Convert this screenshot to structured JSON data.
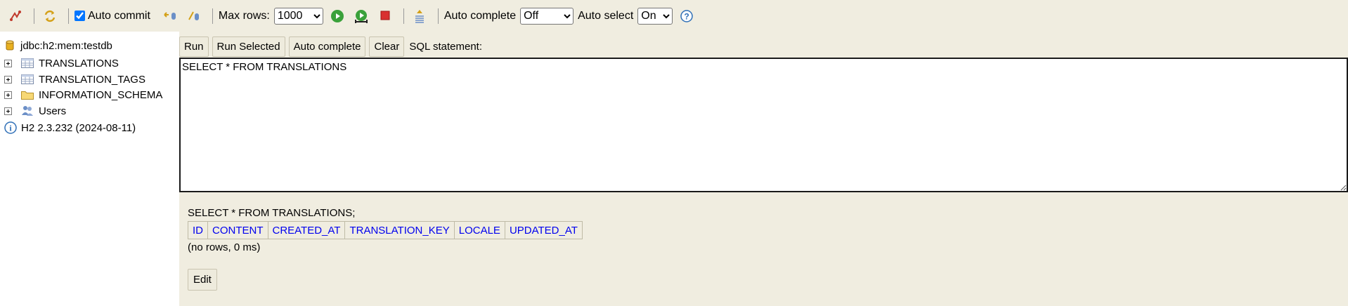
{
  "toolbar": {
    "disconnect_icon": "disconnect-icon",
    "refresh_icon": "refresh-icon",
    "auto_commit_label": "Auto commit",
    "auto_commit_checked": true,
    "rollback_icon": "rollback-icon",
    "commit_icon": "commit-icon",
    "max_rows_label": "Max rows:",
    "max_rows_value": "1000",
    "run_icon": "run-icon",
    "run_selected_icon": "run-selected-icon",
    "stop_icon": "stop-icon",
    "history_icon": "history-icon",
    "auto_complete_label": "Auto complete",
    "auto_complete_value": "Off",
    "auto_select_label": "Auto select",
    "auto_select_value": "On",
    "help_icon": "help-icon"
  },
  "tree": {
    "connection": "jdbc:h2:mem:testdb",
    "items": [
      {
        "label": "TRANSLATIONS",
        "icon": "table-icon"
      },
      {
        "label": "TRANSLATION_TAGS",
        "icon": "table-icon"
      },
      {
        "label": "INFORMATION_SCHEMA",
        "icon": "folder-icon"
      },
      {
        "label": "Users",
        "icon": "users-icon"
      }
    ],
    "version": "H2 2.3.232 (2024-08-11)"
  },
  "editor": {
    "buttons": {
      "run": "Run",
      "run_selected": "Run Selected",
      "auto_complete": "Auto complete",
      "clear": "Clear"
    },
    "sql_label": "SQL statement:",
    "sql_text": "SELECT * FROM TRANSLATIONS"
  },
  "result": {
    "statement": "SELECT * FROM TRANSLATIONS;",
    "columns": [
      "ID",
      "CONTENT",
      "CREATED_AT",
      "TRANSLATION_KEY",
      "LOCALE",
      "UPDATED_AT"
    ],
    "info": "(no rows, 0 ms)",
    "edit_label": "Edit"
  }
}
